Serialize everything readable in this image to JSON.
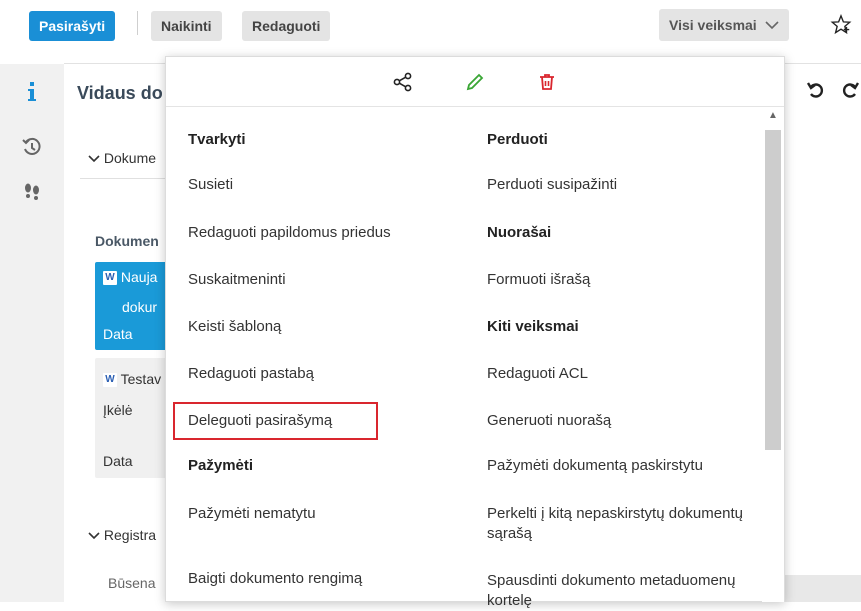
{
  "toolbar": {
    "sign_label": "Pasirašyti",
    "delete_label": "Naikinti",
    "edit_label": "Redaguoti",
    "all_actions_label": "Visi veiksmai"
  },
  "document": {
    "title": "Vidaus do",
    "section_documents": "Dokume",
    "documents_label": "Dokumen",
    "card1_line1": "Nauja",
    "card1_line2": "dokur",
    "card1_line3": "Data",
    "card2_line1": "Testav",
    "card2_line2": "Įkėlė",
    "card2_line3": "Data",
    "section_registration": "Registra",
    "status_label": "Būsena"
  },
  "menu": {
    "left": [
      {
        "label": "Tvarkyti",
        "head": true
      },
      {
        "label": "Susieti",
        "head": false
      },
      {
        "label": "Redaguoti papildomus priedus",
        "head": false
      },
      {
        "label": "Suskaitmeninti",
        "head": false
      },
      {
        "label": "Keisti šabloną",
        "head": false
      },
      {
        "label": "Redaguoti pastabą",
        "head": false
      },
      {
        "label": "Deleguoti pasirašymą",
        "head": false
      },
      {
        "label": "Pažymėti",
        "head": true
      },
      {
        "label": "Pažymėti nematytu",
        "head": false
      },
      {
        "label": "Baigti dokumento rengimą",
        "head": false
      }
    ],
    "right": [
      {
        "label": "Perduoti",
        "head": true
      },
      {
        "label": "Perduoti susipažinti",
        "head": false
      },
      {
        "label": "Nuorašai",
        "head": true
      },
      {
        "label": "Formuoti išrašą",
        "head": false
      },
      {
        "label": "Kiti veiksmai",
        "head": true
      },
      {
        "label": "Redaguoti ACL",
        "head": false
      },
      {
        "label": "Generuoti nuorašą",
        "head": false
      },
      {
        "label": "Pažymėti dokumentą paskirstytu",
        "head": false
      },
      {
        "label": "Perkelti į kitą nepaskirstytų dokumentų sąrašą",
        "head": false
      },
      {
        "label": "Spausdinti dokumento metaduomenų kortelę",
        "head": false
      }
    ]
  },
  "colors": {
    "primary": "#1a8fd6",
    "highlight": "#d9262e",
    "pencil": "#3aa635",
    "trash": "#d9262e"
  }
}
